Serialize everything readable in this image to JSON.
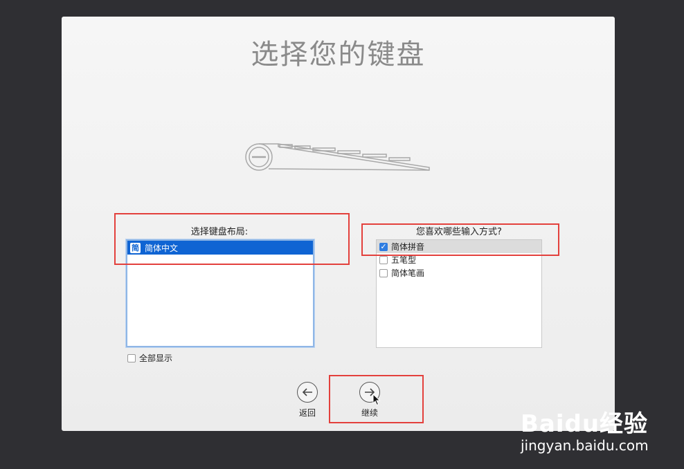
{
  "title": "选择您的键盘",
  "layout_section": {
    "label": "选择键盘布局:",
    "items": [
      {
        "icon_char": "简",
        "label": "简体中文",
        "selected": true
      }
    ]
  },
  "show_all_label": "全部显示",
  "ime_section": {
    "label": "您喜欢哪些输入方式?",
    "items": [
      {
        "label": "简体拼音",
        "checked": true
      },
      {
        "label": "五笔型",
        "checked": false
      },
      {
        "label": "简体笔画",
        "checked": false
      }
    ]
  },
  "nav": {
    "back_label": "返回",
    "continue_label": "继续"
  },
  "watermark": {
    "logo_text": "Baidu经验",
    "url": "jingyan.baidu.com"
  },
  "colors": {
    "selection_blue": "#0f64d3",
    "highlight_red": "#e3403c"
  }
}
